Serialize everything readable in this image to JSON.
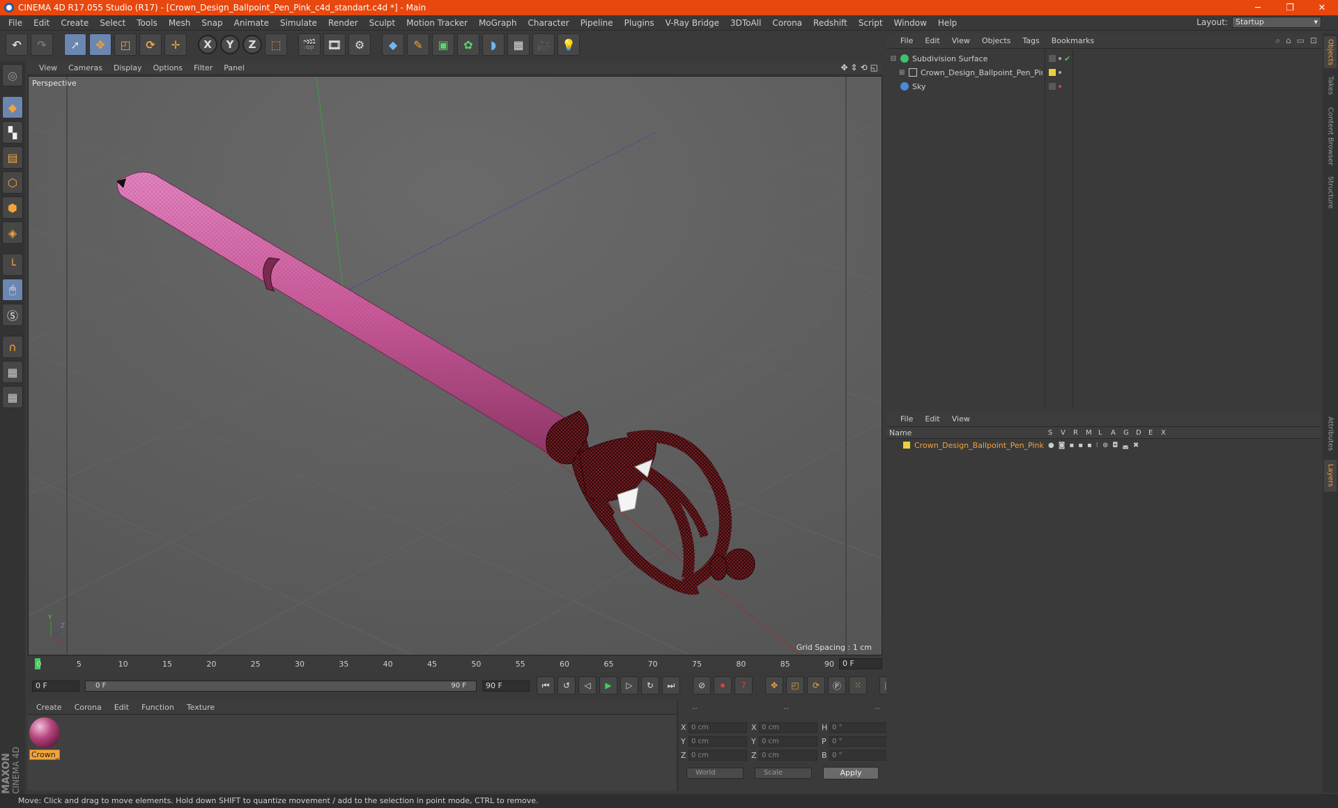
{
  "titlebar": {
    "title": "CINEMA 4D R17.055 Studio (R17) - [Crown_Design_Ballpoint_Pen_Pink_c4d_standart.c4d *] - Main",
    "minimize": "─",
    "maximize": "❐",
    "close": "✕"
  },
  "menu": [
    "File",
    "Edit",
    "Create",
    "Select",
    "Tools",
    "Mesh",
    "Snap",
    "Animate",
    "Simulate",
    "Render",
    "Sculpt",
    "Motion Tracker",
    "MoGraph",
    "Character",
    "Pipeline",
    "Plugins",
    "V-Ray Bridge",
    "3DToAll",
    "Corona",
    "Redshift",
    "Script",
    "Window",
    "Help"
  ],
  "layout": {
    "label": "Layout:",
    "value": "Startup"
  },
  "toolbar": {
    "axis_x": "X",
    "axis_y": "Y",
    "axis_z": "Z"
  },
  "viewport": {
    "menu": [
      "View",
      "Cameras",
      "Display",
      "Options",
      "Filter",
      "Panel"
    ],
    "label": "Perspective",
    "grid_spacing": "Grid Spacing : 1 cm",
    "axis_y": "Y",
    "axis_z": "Z"
  },
  "timeline": {
    "ticks": [
      "0",
      "5",
      "10",
      "15",
      "20",
      "25",
      "30",
      "35",
      "40",
      "45",
      "50",
      "55",
      "60",
      "65",
      "70",
      "75",
      "80",
      "85",
      "90"
    ],
    "current_frame": "0 F",
    "start_field": "0 F",
    "range_start": "0 F",
    "range_end": "90 F",
    "end_field": "90 F"
  },
  "materials": {
    "menu": [
      "Create",
      "Corona",
      "Edit",
      "Function",
      "Texture"
    ],
    "items": [
      {
        "name": "Crown_"
      }
    ]
  },
  "coordinates": {
    "headers": [
      "--",
      "--",
      "--"
    ],
    "rows": [
      {
        "a": "X",
        "av": "0 cm",
        "b": "X",
        "bv": "0 cm",
        "c": "H",
        "cv": "0 °"
      },
      {
        "a": "Y",
        "av": "0 cm",
        "b": "Y",
        "bv": "0 cm",
        "c": "P",
        "cv": "0 °"
      },
      {
        "a": "Z",
        "av": "0 cm",
        "b": "Z",
        "bv": "0 cm",
        "c": "B",
        "cv": "0 °"
      }
    ],
    "space": "World",
    "mode": "Scale",
    "apply": "Apply"
  },
  "objects": {
    "menu": [
      "File",
      "Edit",
      "View",
      "Objects",
      "Tags",
      "Bookmarks"
    ],
    "items": [
      {
        "name": "Subdivision Surface",
        "color": "#3fc06a"
      },
      {
        "name": "Crown_Design_Ballpoint_Pen_Pink",
        "color": "#e8d23a"
      },
      {
        "name": "Sky",
        "color": "#4a8ad8"
      }
    ]
  },
  "layers": {
    "menu": [
      "File",
      "Edit",
      "View"
    ],
    "columns": {
      "name": "Name",
      "flags": [
        "S",
        "V",
        "R",
        "M",
        "L",
        "A",
        "G",
        "D",
        "E",
        "X"
      ]
    },
    "items": [
      {
        "name": "Crown_Design_Ballpoint_Pen_Pink",
        "color": "#e8d23a"
      }
    ]
  },
  "right_tabs": [
    "Objects",
    "Takes",
    "Content Browser",
    "Structure",
    "Attributes",
    "Layers"
  ],
  "status": "Move: Click and drag to move elements. Hold down SHIFT to quantize movement / add to the selection in point mode, CTRL to remove.",
  "brand": {
    "line1": "MAXON",
    "line2": "CINEMA 4D"
  },
  "colors": {
    "title_bar": "#e8470d",
    "accent": "#f2a33a",
    "pen_pink": "#c95a9a",
    "crown_red": "#7a1e22"
  }
}
